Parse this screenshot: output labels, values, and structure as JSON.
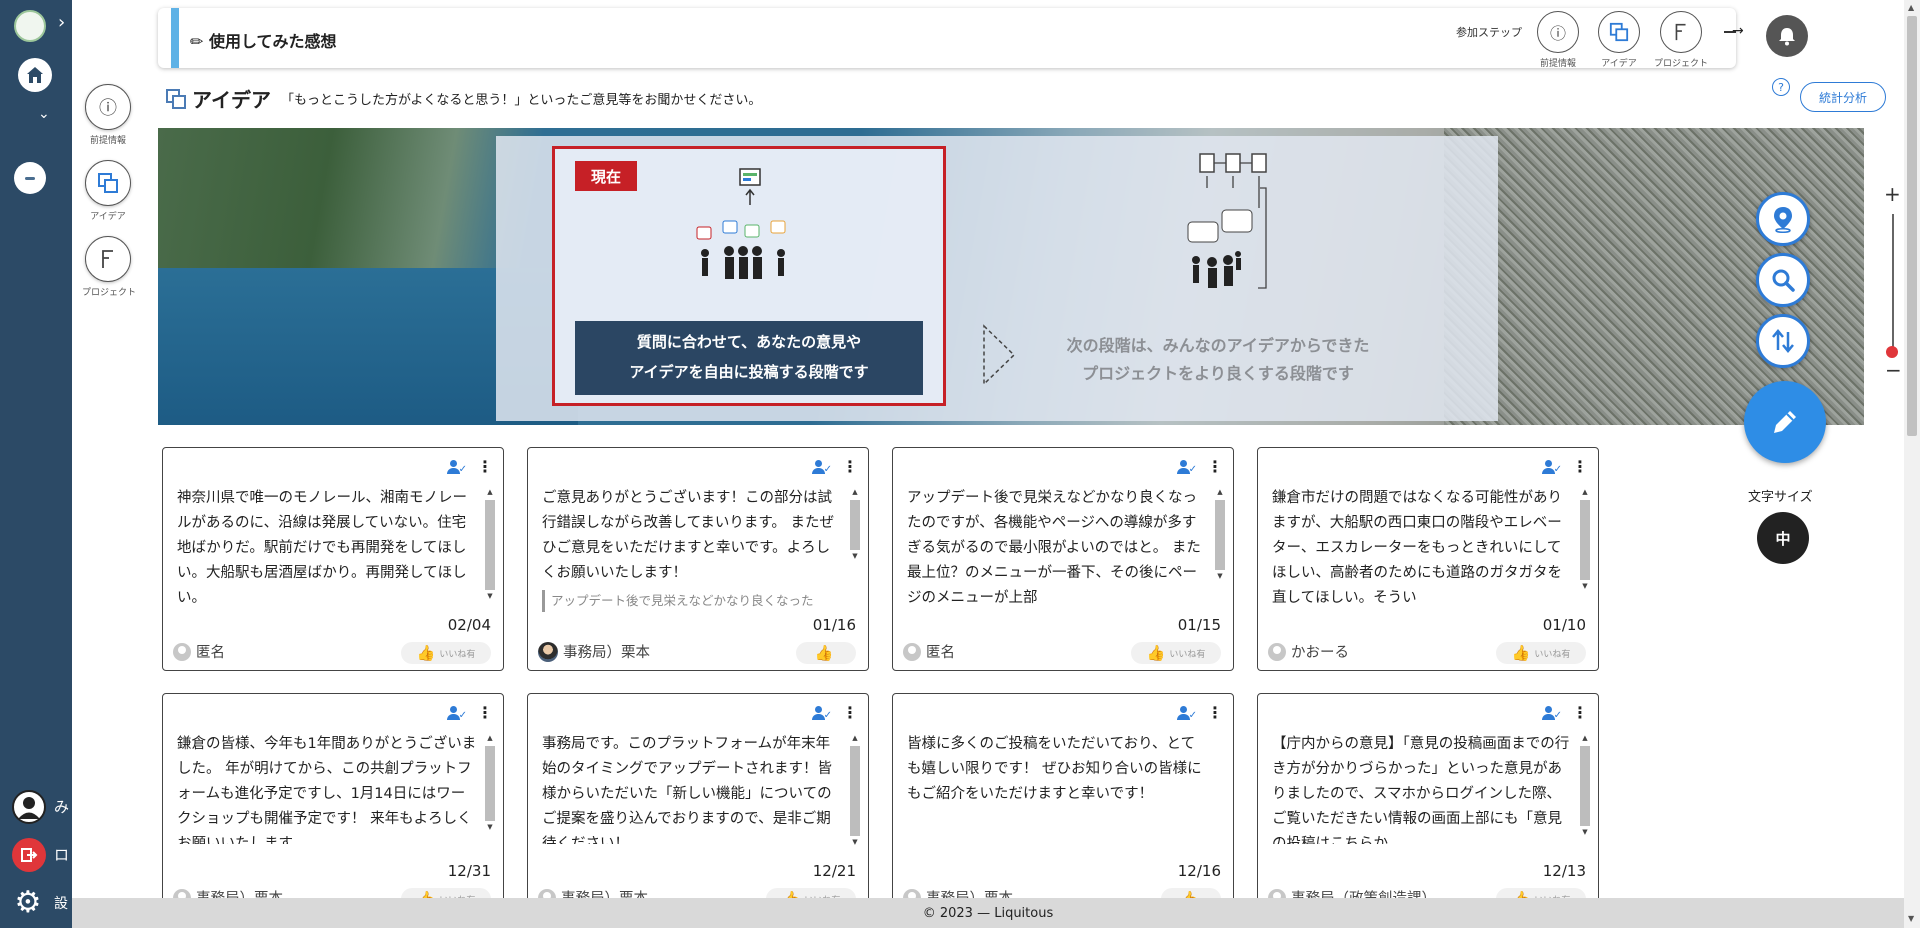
{
  "sidebar": {
    "expand_icon": "chevron-right-icon",
    "user_label": "み",
    "logout_label": "ロ",
    "settings_label": "設"
  },
  "left_steps": [
    {
      "label": "前提情報",
      "icon": "info-icon"
    },
    {
      "label": "アイデア",
      "icon": "idea-icon"
    },
    {
      "label": "プロジェクト",
      "icon": "project-icon"
    }
  ],
  "header": {
    "title": "✏ 使用してみた感想",
    "steps_label": "参加ステップ",
    "steps": [
      {
        "label": "前提情報",
        "icon": "info-icon"
      },
      {
        "label": "アイデア",
        "icon": "idea-icon"
      },
      {
        "label": "プロジェクト",
        "icon": "project-icon"
      }
    ]
  },
  "idea": {
    "title": "アイデア",
    "description": "「もっとこうした方がよくなると思う！」といったご意見等をお聞かせください。",
    "help": "?",
    "stats_button": "統計分析"
  },
  "banner": {
    "now_badge": "現在",
    "current_text_line1": "質問に合わせて、あなたの意見や",
    "current_text_line2": "アイデアを自由に投稿する段階です",
    "next_text_line1": "次の段階は、みんなのアイデアからできた",
    "next_text_line2": "プロジェクトをより良くする段階です"
  },
  "cards": [
    {
      "content": "神奈川県で唯一のモノレール、湘南モノレールがあるのに、沿線は発展していない。住宅地ばかりだ。駅前だけでも再開発をしてほしい。大船駅も居酒屋ばかり。再開発してほしい。",
      "quote": "",
      "date": "02/04",
      "author": "匿名",
      "avatar": "default",
      "like": "いいね有"
    },
    {
      "content": "ご意見ありがとうございます！この部分は試行錯誤しながら改善してまいります。 またぜひご意見をいただけますと幸いです。よろしくお願いいたします！",
      "quote": "アップデート後で見栄えなどかなり良くなった",
      "date": "01/16",
      "author": "事務局）栗本",
      "avatar": "photo",
      "like": ""
    },
    {
      "content": "アップデート後で見栄えなどかなり良くなったのですが、各機能やページへの導線が多すぎる気がるので最小限がよいのではと。 また最上位？のメニューが一番下、その後にページのメニューが上部",
      "quote": "",
      "date": "01/15",
      "author": "匿名",
      "avatar": "default",
      "like": "いいね有"
    },
    {
      "content": "鎌倉市だけの問題ではなくなる可能性がありますが、大船駅の西口東口の階段やエレベーター、エスカレーターをもっときれいにしてほしい、高齢者のためにも道路のガタガタを直してほしい。そうい",
      "quote": "",
      "date": "01/10",
      "author": "かおーる",
      "avatar": "default",
      "like": "いいね有"
    },
    {
      "content": "鎌倉の皆様、今年も1年間ありがとうございました。 年が明けてから、この共創プラットフォームも進化予定ですし、1月14日にはワークショップも開催予定です！ 来年もよろしくお願いいたします。",
      "quote": "",
      "date": "12/31",
      "author": "事務局）栗本",
      "avatar": "default",
      "like": "いいね有"
    },
    {
      "content": "事務局です。このプラットフォームが年末年始のタイミングでアップデートされます！皆様からいただいた「新しい機能」についてのご提案を盛り込んでおりますので、是非ご期待ください！",
      "quote": "",
      "date": "12/21",
      "author": "事務局）栗本",
      "avatar": "default",
      "like": "いいね有"
    },
    {
      "content": "皆様に多くのご投稿をいただいており、とても嬉しい限りです！ ぜひお知り合いの皆様にもご紹介をいただけますと幸いです！",
      "quote": "",
      "date": "12/16",
      "author": "事務局）栗本",
      "avatar": "default",
      "like": ""
    },
    {
      "content": "【庁内からの意見】「意見の投稿画面までの行き方が分かりづらかった」といった意見がありましたので、スマホからログインした際、ご覧いただきたい情報の画面上部にも「意見の投稿はこちらか",
      "quote": "",
      "date": "12/13",
      "author": "事務局（政策創造課）",
      "avatar": "default",
      "like": "いいね有"
    }
  ],
  "right_tools": {
    "location_icon": "map-pin-icon",
    "search_icon": "search-icon",
    "sort_icon": "sort-icon",
    "compose_icon": "pencil-icon",
    "font_size_label": "文字サイズ",
    "font_size_value": "中"
  },
  "zoom": {
    "plus": "+",
    "minus": "−",
    "level": 0.08
  },
  "footer": {
    "text": "© 2023 — Liquitous"
  },
  "colors": {
    "sidebar": "#2c4a66",
    "accent": "#2e7bd6",
    "current": "#c62026",
    "panel_text_bg": "#2b4663"
  }
}
